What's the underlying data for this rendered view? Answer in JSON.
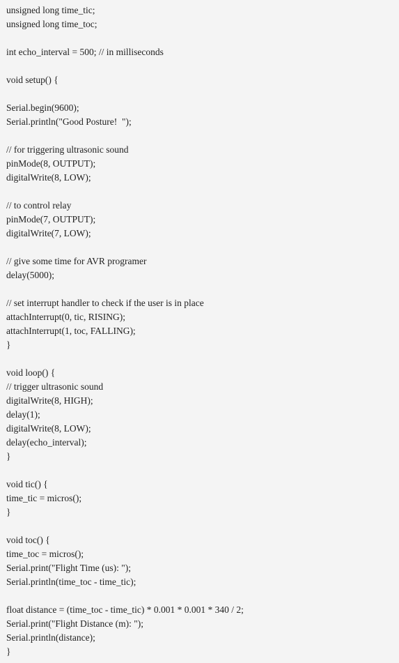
{
  "code": {
    "lines": [
      "unsigned long time_tic;",
      "unsigned long time_toc;",
      "",
      "int echo_interval = 500; // in milliseconds",
      "",
      "void setup() {",
      "",
      "Serial.begin(9600);",
      "Serial.println(\"Good Posture!  \");",
      "",
      "// for triggering ultrasonic sound",
      "pinMode(8, OUTPUT);",
      "digitalWrite(8, LOW);",
      "",
      "// to control relay",
      "pinMode(7, OUTPUT);",
      "digitalWrite(7, LOW);",
      "",
      "// give some time for AVR programer",
      "delay(5000);",
      "",
      "// set interrupt handler to check if the user is in place",
      "attachInterrupt(0, tic, RISING);",
      "attachInterrupt(1, toc, FALLING);",
      "}",
      "",
      "void loop() {",
      "// trigger ultrasonic sound",
      "digitalWrite(8, HIGH);",
      "delay(1);",
      "digitalWrite(8, LOW);",
      "delay(echo_interval);",
      "}",
      "",
      "void tic() {",
      "time_tic = micros();",
      "}",
      "",
      "void toc() {",
      "time_toc = micros();",
      "Serial.print(\"Flight Time (us): \");",
      "Serial.println(time_toc - time_tic);",
      "",
      "float distance = (time_toc - time_tic) * 0.001 * 0.001 * 340 / 2;",
      "Serial.print(\"Flight Distance (m): \");",
      "Serial.println(distance);",
      "}"
    ]
  }
}
